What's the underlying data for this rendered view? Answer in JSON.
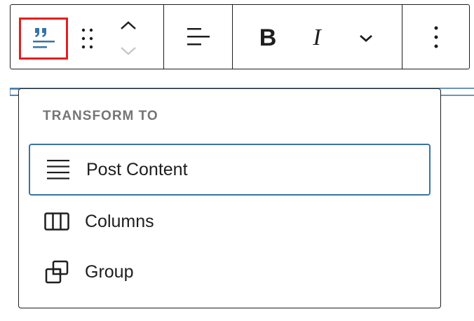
{
  "toolbar": {
    "block_icon": "quote-icon",
    "drag_icon": "drag-handle-icon",
    "move_up_icon": "chevron-up-icon",
    "move_down_icon": "chevron-down-icon",
    "align_icon": "align-left-icon",
    "bold_label": "B",
    "italic_label": "I",
    "more_icon": "chevron-down-icon",
    "options_icon": "more-vertical-icon",
    "highlight_color": "#e41e1e",
    "accent_color": "#3873a5"
  },
  "transform_menu": {
    "heading": "TRANSFORM TO",
    "items": [
      {
        "label": "Post Content",
        "icon": "post-content-icon",
        "focused": true
      },
      {
        "label": "Columns",
        "icon": "columns-icon"
      },
      {
        "label": "Group",
        "icon": "group-icon"
      }
    ]
  }
}
